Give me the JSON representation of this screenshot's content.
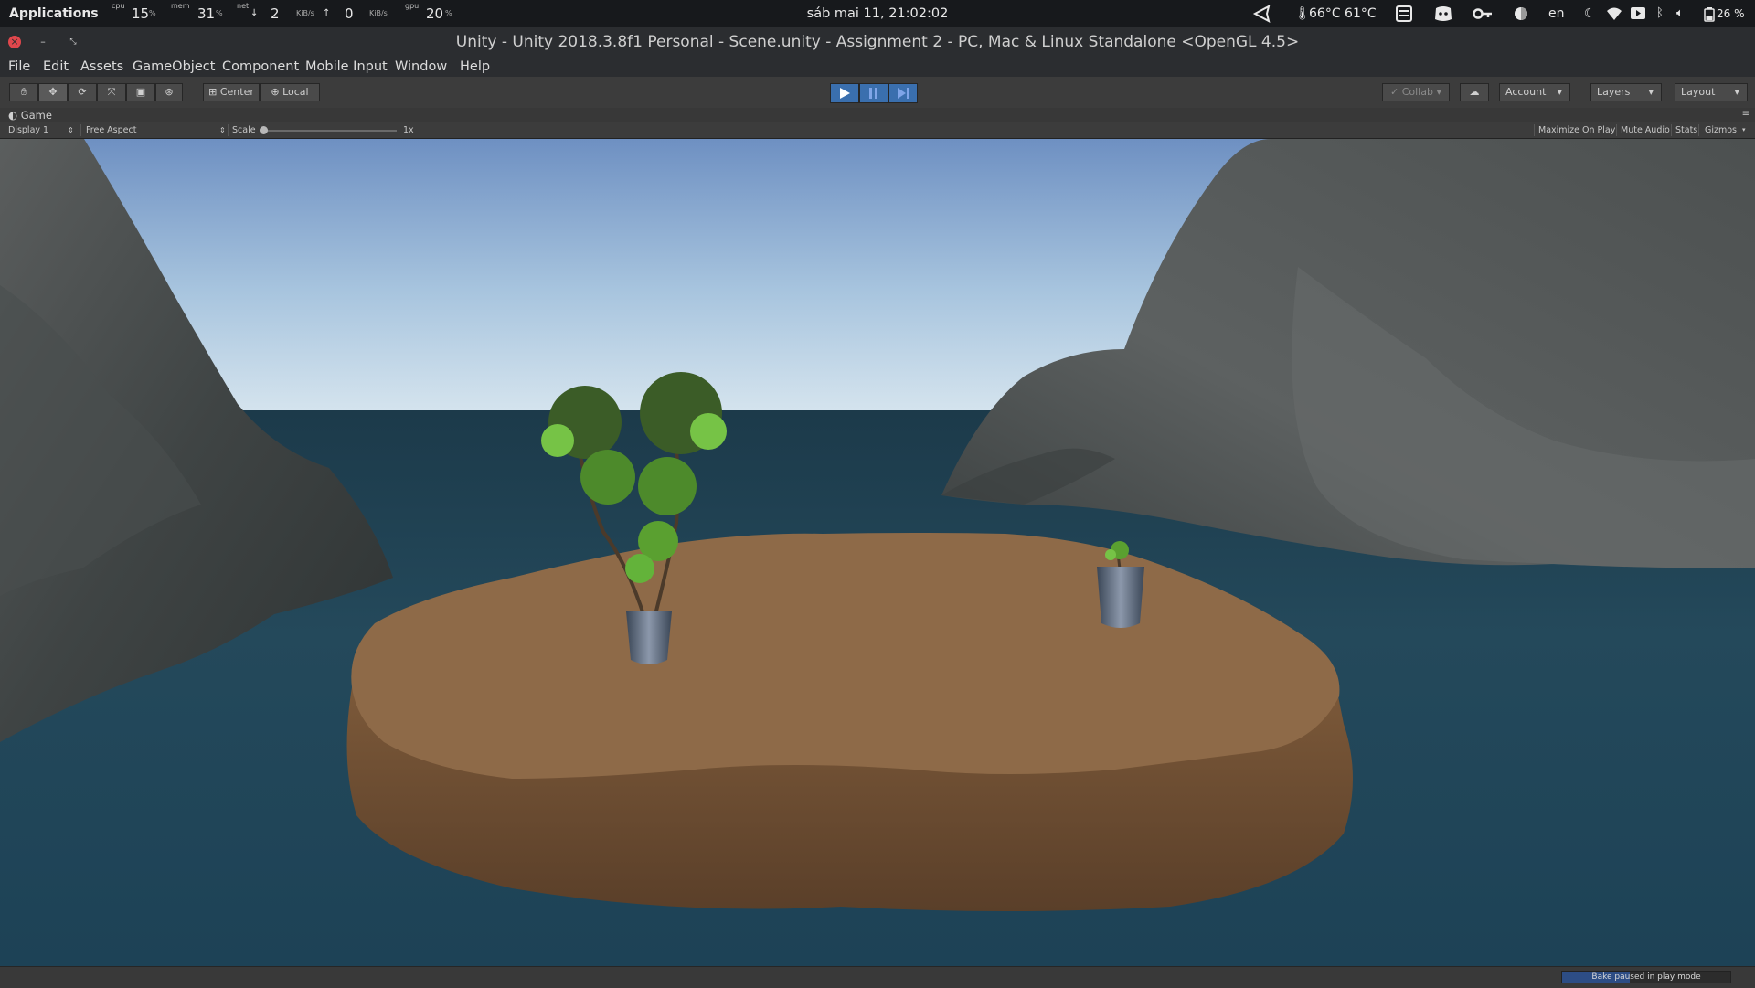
{
  "system_bar": {
    "applications": "Applications",
    "cpu_label": "cpu",
    "cpu_value": "15",
    "cpu_unit": "%",
    "mem_label": "mem",
    "mem_value": "31",
    "mem_unit": "%",
    "net_label": "net",
    "net_down": "2",
    "net_down_unit": "KiB/s",
    "net_up": "0",
    "net_up_unit": "KiB/s",
    "gpu_label": "gpu",
    "gpu_value": "20",
    "gpu_unit": "%",
    "clock": "sáb mai 11, 21:02:02",
    "temps": "66°C 61°C",
    "language": "en",
    "battery": "26 %"
  },
  "window": {
    "title": "Unity - Unity 2018.3.8f1 Personal - Scene.unity - Assignment 2 - PC, Mac & Linux Standalone <OpenGL 4.5>"
  },
  "menu": [
    "File",
    "Edit",
    "Assets",
    "GameObject",
    "Component",
    "Mobile Input",
    "Window",
    "Help"
  ],
  "toolbar": {
    "pivot": "Center",
    "space": "Local",
    "collab": "Collab",
    "account": "Account",
    "layers": "Layers",
    "layout": "Layout"
  },
  "game_view": {
    "tab_label": "Game",
    "display": "Display 1",
    "aspect": "Free Aspect",
    "scale_label": "Scale",
    "scale_value": "1x",
    "maximize": "Maximize On Play",
    "mute": "Mute Audio",
    "stats": "Stats",
    "gizmos": "Gizmos"
  },
  "status": {
    "bake_text": "Bake paused in play mode",
    "bake_progress": 0.4
  },
  "colors": {
    "play_active": "#3a6fae",
    "sky_top": "#6e90c2",
    "sea": "#234a5c",
    "island_top": "#8e6a48"
  }
}
